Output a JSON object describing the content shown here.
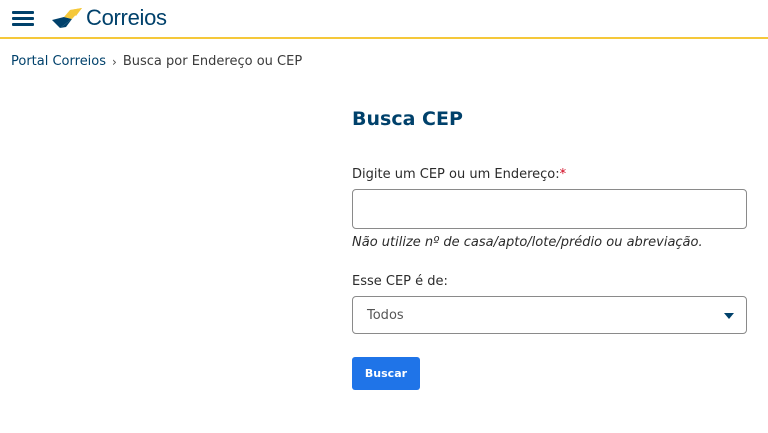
{
  "header": {
    "logo_text": "Correios",
    "brand_blue": "#00416b",
    "brand_yellow": "#f5c83a",
    "menu_icon": "hamburger-menu-icon"
  },
  "breadcrumb": {
    "home": "Portal Correios",
    "separator": "›",
    "current": "Busca por Endereço ou CEP"
  },
  "form": {
    "title": "Busca CEP",
    "cep_label": "Digite um CEP ou um Endereço:",
    "required_mark": "*",
    "cep_value": "",
    "cep_placeholder": "",
    "hint": "Não utilize nº de casa/apto/lote/prédio ou abreviação.",
    "tipo_label": "Esse CEP é de:",
    "tipo_selected": "Todos",
    "submit_label": "Buscar",
    "button_color": "#1f74e8"
  }
}
